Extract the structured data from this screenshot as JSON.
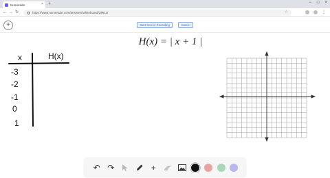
{
  "browser": {
    "tab_title": "Numerade",
    "tab_close": "×",
    "new_tab": "+",
    "url": "https://www.numerade.com/answers/whiteboard/29611/",
    "back": "←",
    "forward": "→",
    "reload": "↻",
    "star": "☆",
    "window_controls": [
      "−",
      "□",
      "×"
    ],
    "menu": "⋮"
  },
  "toolbar": {
    "add_button": "+",
    "record_button": "Start Screen Recording",
    "cancel_button": "Cancel"
  },
  "whiteboard": {
    "equation": "H(x) = | x + 1 |",
    "table_header_x": "x",
    "table_header_hx": "H(x)",
    "table_x_values": [
      "-3",
      "-2",
      "-1",
      "0",
      "1"
    ],
    "grid": {
      "cols": 16,
      "rows": 16,
      "color": "#9a9a9a"
    }
  },
  "bottom_tools": {
    "undo": "↶",
    "redo": "↷",
    "select": "pointer-icon",
    "pen": "pencil-icon",
    "add": "+",
    "eraser": "eraser-icon",
    "image": "image-icon",
    "colors": [
      "#111111",
      "#e8a3a3",
      "#a8d8b9",
      "#b9b9f0"
    ]
  }
}
